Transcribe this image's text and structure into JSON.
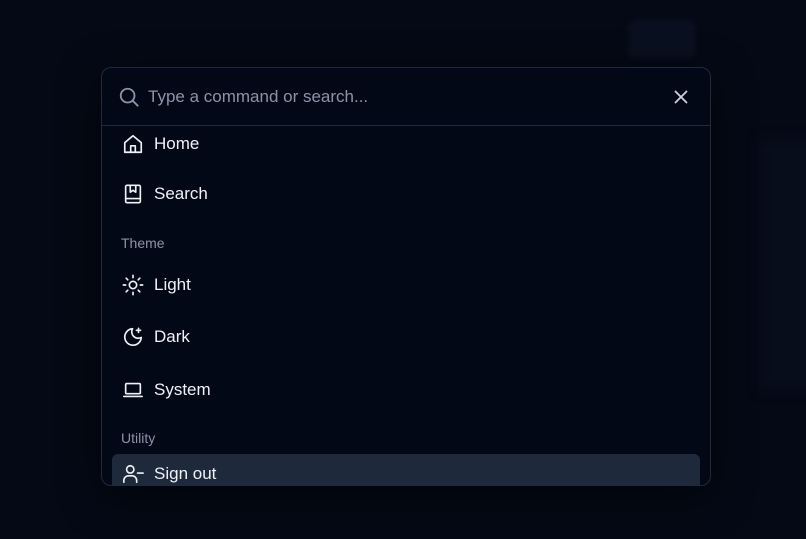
{
  "search": {
    "placeholder": "Type a command or search..."
  },
  "groups": [
    {
      "heading": "",
      "items": [
        {
          "label": "Home",
          "icon": "home-icon"
        },
        {
          "label": "Search",
          "icon": "book-bookmark-icon"
        }
      ]
    },
    {
      "heading": "Theme",
      "items": [
        {
          "label": "Light",
          "icon": "sun-icon"
        },
        {
          "label": "Dark",
          "icon": "moon-icon"
        },
        {
          "label": "System",
          "icon": "laptop-icon"
        }
      ]
    },
    {
      "heading": "Utility",
      "items": [
        {
          "label": "Sign out",
          "icon": "user-minus-icon",
          "selected": true
        }
      ]
    }
  ],
  "colors": {
    "background": "#040915",
    "panel": "#030817",
    "border": "#1f2a3c",
    "text": "#eef2f7",
    "muted": "#8a94a6",
    "selected": "#1e293b"
  }
}
